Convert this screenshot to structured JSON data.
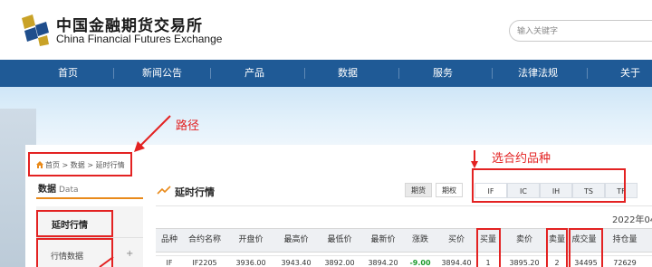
{
  "header": {
    "logo_cn": "中国金融期货交易所",
    "logo_en": "China Financial Futures Exchange",
    "search_placeholder": "输入关键字"
  },
  "nav": {
    "items": [
      "首页",
      "新闻公告",
      "产品",
      "数据",
      "服务",
      "法律法规",
      "关于"
    ]
  },
  "breadcrumb": {
    "home": "首页",
    "sep": ">",
    "level1": "数据",
    "level2": "延时行情"
  },
  "sidebar": {
    "title": "数据",
    "title_en": "Data",
    "items": [
      {
        "label": "延时行情"
      },
      {
        "label": "行情数据",
        "expand": "+"
      }
    ]
  },
  "main": {
    "title": "延时行情",
    "toggles": [
      "期货",
      "期权"
    ],
    "product_tabs": [
      "IF",
      "IC",
      "IH",
      "TS",
      "TF"
    ],
    "date": "2022年04"
  },
  "table": {
    "headers": [
      "品种",
      "合约名称",
      "开盘价",
      "最高价",
      "最低价",
      "最新价",
      "涨跌",
      "买价",
      "买量",
      "卖价",
      "卖量",
      "成交量",
      "持仓量"
    ],
    "rows": [
      [
        "IF",
        "IF2205",
        "3936.00",
        "3943.40",
        "3892.00",
        "3894.20",
        "-9.00",
        "3894.40",
        "1",
        "3895.20",
        "2",
        "34495",
        "72629"
      ]
    ]
  },
  "annotations": {
    "path_label": "路径",
    "contract_label": "选合约品种"
  },
  "colors": {
    "nav_bg": "#1f5a96",
    "accent_orange": "#e98a1b",
    "annotation_red": "#e32222",
    "negative_green": "#1c9a2b"
  }
}
